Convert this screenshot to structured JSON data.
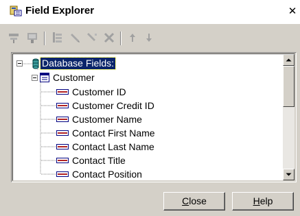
{
  "window": {
    "title": "Field Explorer",
    "close_glyph": "✕"
  },
  "toolbar": {
    "buttons": [
      {
        "name": "insert-to-report-icon"
      },
      {
        "name": "browse-data-icon"
      },
      {
        "name": "new-icon"
      },
      {
        "name": "edit-icon"
      },
      {
        "name": "rename-icon"
      },
      {
        "name": "delete-icon"
      },
      {
        "name": "move-up-icon"
      },
      {
        "name": "move-down-icon"
      }
    ]
  },
  "tree": {
    "root": {
      "label": "Database Fields:",
      "expander": "−",
      "selected": true
    },
    "table": {
      "label": "Customer",
      "expander": "−"
    },
    "fields": [
      "Customer ID",
      "Customer Credit ID",
      "Customer Name",
      "Contact First Name",
      "Contact Last Name",
      "Contact Title",
      "Contact Position"
    ]
  },
  "scrollbar": {
    "up_glyph": "▲",
    "down_glyph": "▼"
  },
  "buttons": {
    "close_label_pre": "",
    "close_label_acc": "C",
    "close_label_post": "lose",
    "help_label_pre": "",
    "help_label_acc": "H",
    "help_label_post": "elp"
  },
  "colors": {
    "selection_bg": "#0a246a",
    "face": "#d4d0c8",
    "field_icon": "#b22222"
  }
}
